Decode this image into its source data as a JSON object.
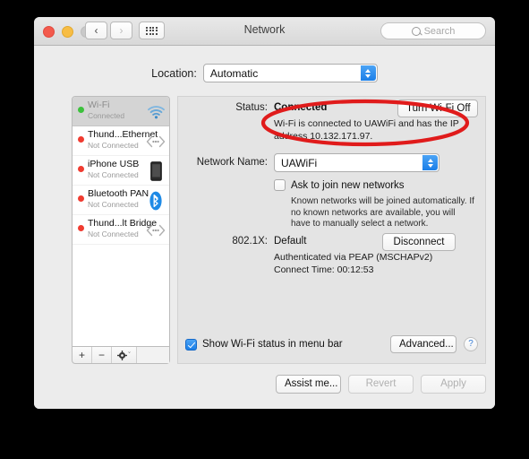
{
  "window": {
    "title": "Network",
    "traffic_lights": [
      "close",
      "minimize",
      "zoom"
    ],
    "nav_back": "‹",
    "nav_forward": "›",
    "grid_button": "show-all-icon"
  },
  "search": {
    "placeholder": "Search",
    "icon": "search-icon"
  },
  "location": {
    "label": "Location:",
    "value": "Automatic"
  },
  "sidebar": {
    "items": [
      {
        "name": "Wi-Fi",
        "status": "Connected",
        "dot_color": "#3cc13c",
        "icon": "wifi-icon",
        "selected": true
      },
      {
        "name": "Thund...Ethernet",
        "status": "Not Connected",
        "dot_color": "#f03b30",
        "icon": "thunderbolt-icon",
        "selected": false
      },
      {
        "name": "iPhone USB",
        "status": "Not Connected",
        "dot_color": "#f03b30",
        "icon": "iphone-icon",
        "selected": false
      },
      {
        "name": "Bluetooth PAN",
        "status": "Not Connected",
        "dot_color": "#f03b30",
        "icon": "bluetooth-icon",
        "selected": false
      },
      {
        "name": "Thund...lt Bridge",
        "status": "Not Connected",
        "dot_color": "#f03b30",
        "icon": "thunderbolt-icon",
        "selected": false
      }
    ],
    "toolbar": {
      "add": "+",
      "remove": "−",
      "gear": "gear-icon",
      "gear_chevron": "ˇ"
    }
  },
  "main": {
    "status_label": "Status:",
    "status_value": "Connected",
    "wifi_toggle_button": "Turn Wi-Fi Off",
    "status_description": "Wi-Fi is connected to UAWiFi and has the IP address 10.132.171.97.",
    "network_name_label": "Network Name:",
    "network_name_value": "UAWiFi",
    "ask_join_label": "Ask to join new networks",
    "ask_join_checked": false,
    "hint": "Known networks will be joined automatically. If no known networks are available, you will have to manually select a network.",
    "dot1x_label": "802.1X:",
    "dot1x_value": "Default",
    "disconnect_button": "Disconnect",
    "auth_line": "Authenticated via PEAP (MSCHAPv2)",
    "connect_time_line": "Connect Time: 00:12:53",
    "show_status_label": "Show Wi-Fi status in menu bar",
    "show_status_checked": true,
    "advanced_button": "Advanced...",
    "help_button": "?"
  },
  "footer": {
    "assist_button": "Assist me...",
    "revert_button": "Revert",
    "apply_button": "Apply"
  },
  "annotation": {
    "shape": "red-oval-highlight",
    "color": "#e01b1b"
  }
}
